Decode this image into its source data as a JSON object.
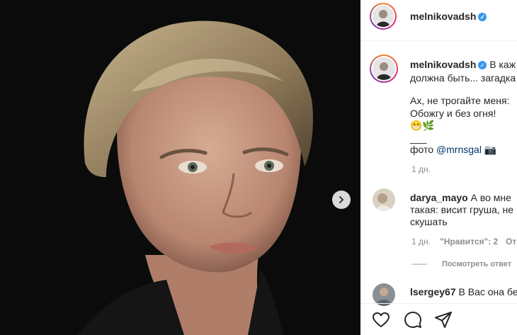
{
  "post": {
    "author": "melnikovadsh",
    "caption_line1": "В каж",
    "caption_line2": "должна быть... загадка",
    "caption_line3": "Ах, не трогайте меня:",
    "caption_line4": "Обожгу и без огня!",
    "caption_emoji": "😁🌿",
    "caption_divider": "___",
    "photo_credit_prefix": "фото ",
    "photo_credit_mention": "@mrnsgal",
    "photo_credit_emoji": "📷",
    "time": "1 дн."
  },
  "comments": [
    {
      "user": "darya_mayo",
      "text1": "А во мне",
      "text2": "такая: висит груша, не",
      "text3": "скушать",
      "time": "1 дн.",
      "likes": "\"Нравится\": 2",
      "reply": "Отв",
      "view_replies_line": "——",
      "view_replies": "Посмотреть ответ"
    },
    {
      "user": "lsergey67",
      "text1": "В Вас она бе"
    }
  ],
  "icons": {
    "verified": "verified-badge-icon",
    "next": "chevron-right-icon",
    "like": "heart-icon",
    "comment": "comment-icon",
    "share": "paper-plane-icon"
  },
  "colors": {
    "verified": "#3897f0",
    "link": "#00376b",
    "muted": "#8e8e8e",
    "photo_bg": "#0b0b0b"
  }
}
